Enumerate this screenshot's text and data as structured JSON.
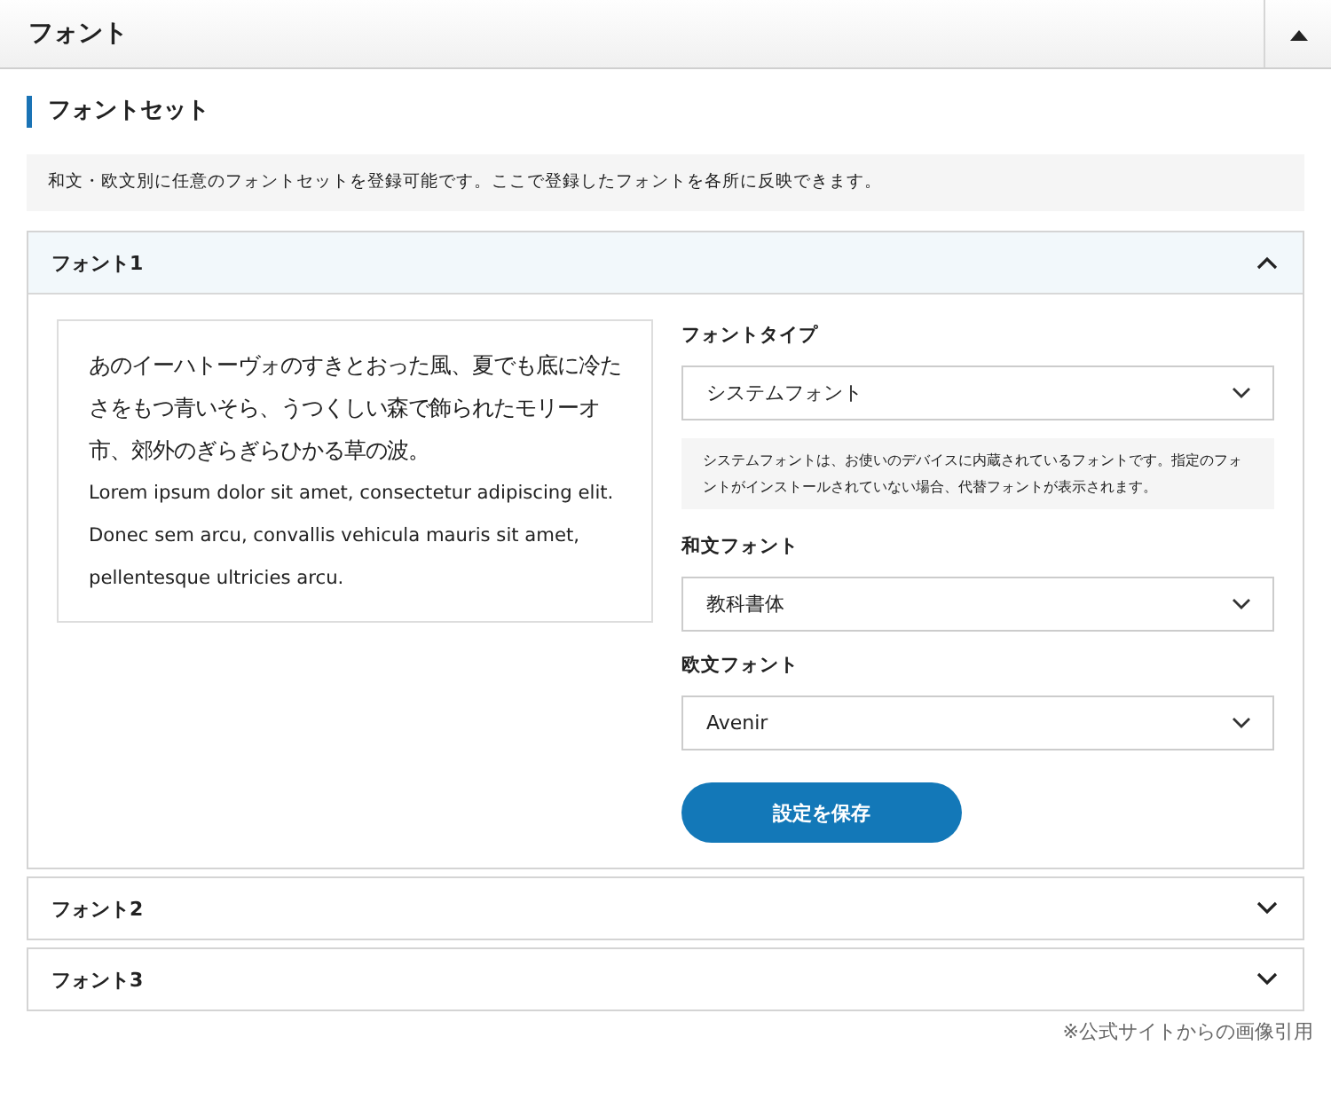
{
  "panel": {
    "title": "フォント",
    "expanded": true
  },
  "section": {
    "title": "フォントセット",
    "description": "和文・欧文別に任意のフォントセットを登録可能です。ここで登録したフォントを各所に反映できます。"
  },
  "fontsets": [
    {
      "title": "フォント1",
      "expanded": true,
      "preview": {
        "japanese": "あのイーハトーヴォのすきとおった風、夏でも底に冷たさをもつ青いそら、うつくしい森で飾られたモリーオ市、郊外のぎらぎらひかる草の波。",
        "latin": "Lorem ipsum dolor sit amet, consectetur adipiscing elit. Donec sem arcu, convallis vehicula mauris sit amet, pellentesque ultricies arcu."
      },
      "fields": [
        {
          "kind": "select",
          "label": "フォントタイプ",
          "value": "システムフォント"
        },
        {
          "kind": "note",
          "text": "システムフォントは、お使いのデバイスに内蔵されているフォントです。指定のフォントがインストールされていない場合、代替フォントが表示されます。"
        },
        {
          "kind": "select",
          "label": "和文フォント",
          "value": "教科書体"
        },
        {
          "kind": "select",
          "label": "欧文フォント",
          "value": "Avenir"
        }
      ],
      "save_button": "設定を保存"
    },
    {
      "title": "フォント2",
      "expanded": false
    },
    {
      "title": "フォント3",
      "expanded": false
    }
  ],
  "caption": "※公式サイトからの画像引用"
}
